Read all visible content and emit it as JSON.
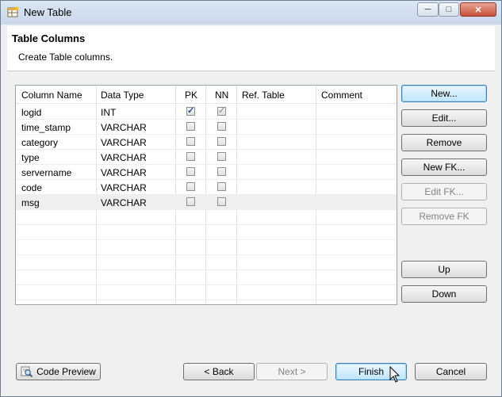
{
  "window": {
    "title": "New Table"
  },
  "header": {
    "title": "Table Columns",
    "subtitle": "Create Table columns."
  },
  "table": {
    "columns": [
      "Column Name",
      "Data Type",
      "PK",
      "NN",
      "Ref. Table",
      "Comment"
    ],
    "rows": [
      {
        "name": "logid",
        "type": "INT",
        "pk": true,
        "nn": true
      },
      {
        "name": "time_stamp",
        "type": "VARCHAR",
        "pk": false,
        "nn": false
      },
      {
        "name": "category",
        "type": "VARCHAR",
        "pk": false,
        "nn": false
      },
      {
        "name": "type",
        "type": "VARCHAR",
        "pk": false,
        "nn": false
      },
      {
        "name": "servername",
        "type": "VARCHAR",
        "pk": false,
        "nn": false
      },
      {
        "name": "code",
        "type": "VARCHAR",
        "pk": false,
        "nn": false
      },
      {
        "name": "msg",
        "type": "VARCHAR",
        "pk": false,
        "nn": false
      }
    ]
  },
  "side_buttons": {
    "new": "New...",
    "edit": "Edit...",
    "remove": "Remove",
    "new_fk": "New FK...",
    "edit_fk": "Edit FK...",
    "remove_fk": "Remove FK",
    "up": "Up",
    "down": "Down"
  },
  "footer": {
    "code_preview": "Code Preview",
    "back": "< Back",
    "next": "Next >",
    "finish": "Finish",
    "cancel": "Cancel"
  }
}
